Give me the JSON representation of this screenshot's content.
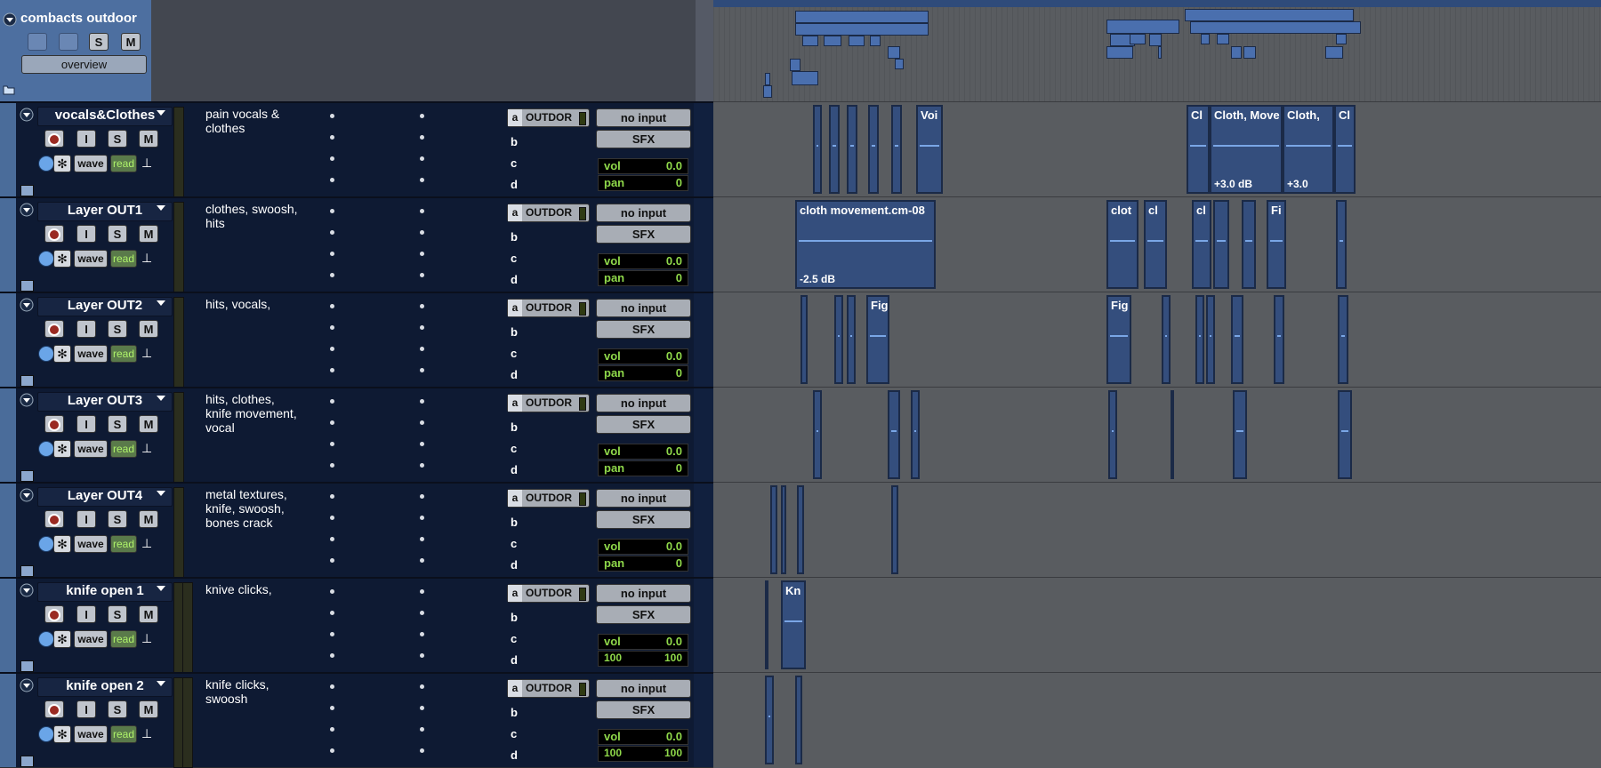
{
  "folder": {
    "title": "combacts outdoor",
    "buttons": [
      "S",
      "M"
    ],
    "overview_label": "overview"
  },
  "tracks": [
    {
      "name": "vocals&Clothes",
      "comment": "pain vocals &\nclothes",
      "rec": "",
      "input": "I",
      "solo": "S",
      "mute": "M",
      "view": "wave",
      "auto": "read",
      "send_a": "OUTDOR",
      "io_in": "no input",
      "io_out": "SFX",
      "vol_label": "vol",
      "vol": "0.0",
      "pan_label": "pan",
      "pan": "0",
      "inserts": [
        "a",
        "b",
        "c",
        "d"
      ]
    },
    {
      "name": "Layer OUT1",
      "comment": "clothes, swoosh,\nhits",
      "rec": "",
      "input": "I",
      "solo": "S",
      "mute": "M",
      "view": "wave",
      "auto": "read",
      "send_a": "OUTDOR",
      "io_in": "no input",
      "io_out": "SFX",
      "vol_label": "vol",
      "vol": "0.0",
      "pan_label": "pan",
      "pan": "0",
      "inserts": [
        "a",
        "b",
        "c",
        "d"
      ]
    },
    {
      "name": "Layer OUT2",
      "comment": " hits, vocals,",
      "rec": "",
      "input": "I",
      "solo": "S",
      "mute": "M",
      "view": "wave",
      "auto": "read",
      "send_a": "OUTDOR",
      "io_in": "no input",
      "io_out": "SFX",
      "vol_label": "vol",
      "vol": "0.0",
      "pan_label": "pan",
      "pan": "0",
      "inserts": [
        "a",
        "b",
        "c",
        "d"
      ]
    },
    {
      "name": "Layer OUT3",
      "comment": " hits, clothes,\nknife movement,\nvocal",
      "rec": "",
      "input": "I",
      "solo": "S",
      "mute": "M",
      "view": "wave",
      "auto": "read",
      "send_a": "OUTDOR",
      "io_in": "no input",
      "io_out": "SFX",
      "vol_label": "vol",
      "vol": "0.0",
      "pan_label": "pan",
      "pan": "0",
      "inserts": [
        "a",
        "b",
        "c",
        "d"
      ]
    },
    {
      "name": "Layer OUT4",
      "comment": "metal textures,\nknife, swoosh,\nbones crack",
      "rec": "",
      "input": "I",
      "solo": "S",
      "mute": "M",
      "view": "wave",
      "auto": "read",
      "send_a": "OUTDOR",
      "io_in": "no input",
      "io_out": "SFX",
      "vol_label": "vol",
      "vol": "0.0",
      "pan_label": "pan",
      "pan": "0",
      "inserts": [
        "a",
        "b",
        "c",
        "d"
      ]
    },
    {
      "name": "knife open 1",
      "comment": "knive clicks,",
      "rec": "",
      "input": "I",
      "solo": "S",
      "mute": "M",
      "view": "wave",
      "auto": "read",
      "send_a": "OUTDOR",
      "io_in": "no input",
      "io_out": "SFX",
      "vol_label": "vol",
      "vol": "0.0",
      "pan_left": "100",
      "pan_right": "100",
      "inserts": [
        "a",
        "b",
        "c",
        "d"
      ]
    },
    {
      "name": "knife open 2",
      "comment": "knife clicks,\nswoosh",
      "rec": "",
      "input": "I",
      "solo": "S",
      "mute": "M",
      "view": "wave",
      "auto": "read",
      "send_a": "OUTDOR",
      "io_in": "no input",
      "io_out": "SFX",
      "vol_label": "vol",
      "vol": "0.0",
      "pan_left": "100",
      "pan_right": "100",
      "inserts": [
        "a",
        "b",
        "c",
        "d"
      ]
    }
  ],
  "clips": {
    "t0": [
      {
        "label": "Voi"
      }
    ],
    "t0_big": [
      {
        "label": "Cl"
      },
      {
        "label": "Cloth, Move"
      },
      {
        "label": "Cloth, "
      },
      {
        "label": "Cl"
      }
    ],
    "t0_gains": [
      "+3.0 dB",
      "+3.0"
    ],
    "t1": [
      {
        "label": "cloth movement.cm-08",
        "gain": "-2.5 dB"
      },
      {
        "label": "clot"
      },
      {
        "label": "cl"
      },
      {
        "label": "cl"
      },
      {
        "label": "Fi"
      }
    ],
    "t2": [
      {
        "label": "Fig"
      },
      {
        "label": "Fig"
      }
    ],
    "t5": [
      {
        "label": "Kn"
      }
    ]
  },
  "colors": {
    "track_bg": "#0e1a33",
    "clip_fill": "#344e7d",
    "folder_accent": "#4d6fa0",
    "meter_green": "#8fd84a"
  }
}
